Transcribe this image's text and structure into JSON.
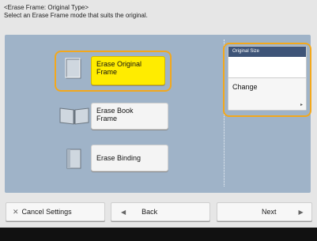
{
  "header": {
    "title": "<Erase Frame: Original Type>",
    "instruction": "Select an Erase Frame mode that suits the original."
  },
  "options": [
    {
      "label_line1": "Erase Original",
      "label_line2": "Frame",
      "selected": true,
      "icon": "single-sheet-icon"
    },
    {
      "label_line1": "Erase Book",
      "label_line2": "Frame",
      "selected": false,
      "icon": "open-book-icon"
    },
    {
      "label_line1": "Erase Binding",
      "label_line2": "",
      "selected": false,
      "icon": "binding-sheet-icon"
    }
  ],
  "original_size": {
    "title": "Original Size",
    "value": "",
    "change_label": "Change"
  },
  "footer_buttons": {
    "cancel_label": "Cancel Settings",
    "back_label": "Back",
    "next_label": "Next"
  },
  "colors": {
    "panel": "#9fb3c8",
    "selected": "#ffec00",
    "highlight": "#f3a81c",
    "title_bar": "#3e5478"
  }
}
